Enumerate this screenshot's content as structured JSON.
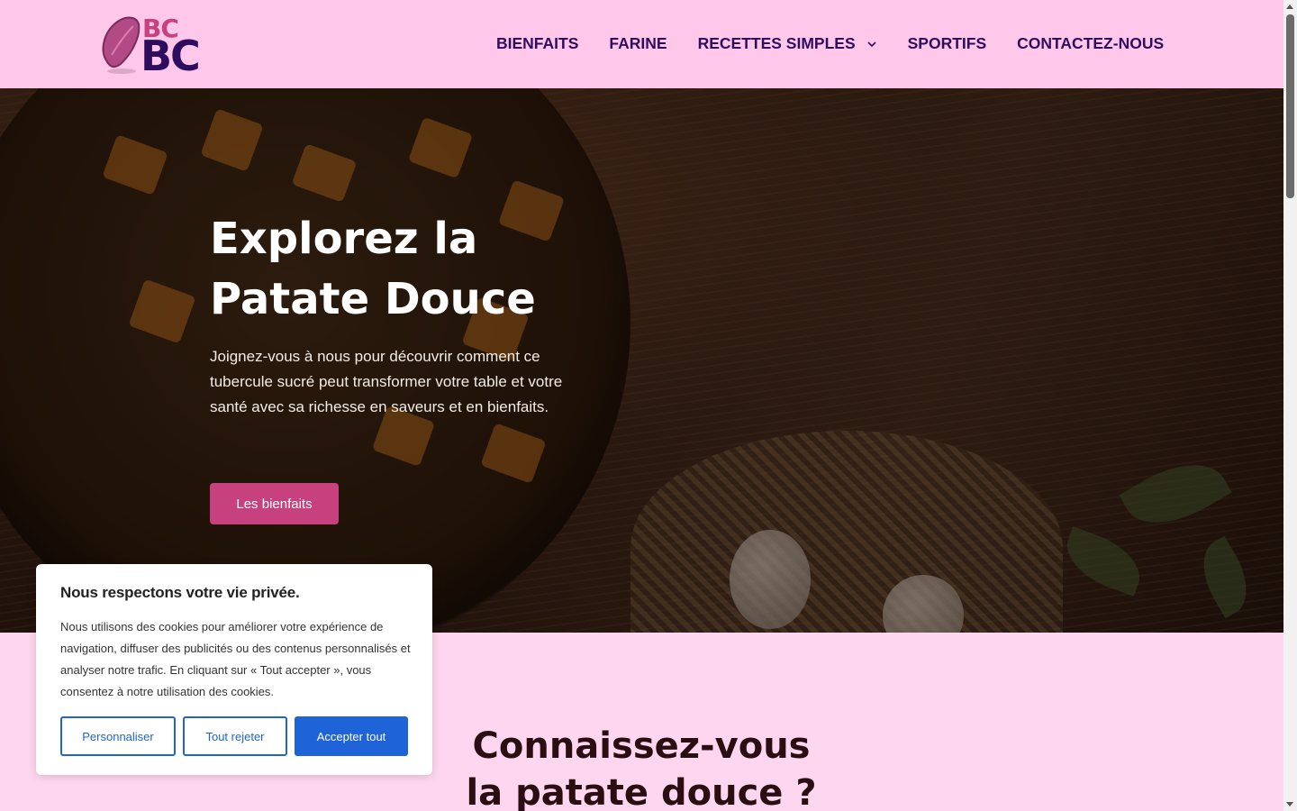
{
  "header": {
    "logo_text_top": "BC",
    "logo_text_bottom": "BC",
    "nav": [
      {
        "label": "BIENFAITS"
      },
      {
        "label": "FARINE"
      },
      {
        "label": "RECETTES SIMPLES"
      },
      {
        "label": "SPORTIFS"
      },
      {
        "label": "CONTACTEZ-NOUS"
      }
    ]
  },
  "hero": {
    "title_line1": "Explorez la",
    "title_line2": "Patate Douce",
    "text": "Joignez-vous à nous pour découvrir comment ce tubercule sucré peut transformer votre table et votre santé avec sa richesse en saveurs et en bienfaits.",
    "button_label": "Les bienfaits"
  },
  "section": {
    "title_line1": "Connaissez-vous",
    "title_line2": "la patate douce ?"
  },
  "cookie": {
    "title": "Nous respectons votre vie privée.",
    "text": "Nous utilisons des cookies pour améliorer votre expérience de navigation, diffuser des publicités ou des contenus personnalisés et analyser notre trafic. En cliquant sur « Tout accepter », vous consentez à notre utilisation des cookies.",
    "btn_customize": "Personnaliser",
    "btn_reject": "Tout rejeter",
    "btn_accept": "Accepter tout"
  },
  "colors": {
    "header_bg": "#ffc7ea",
    "page_bg": "#ffd6ef",
    "brand_purple": "#2f0d5e",
    "brand_pink": "#c8417f",
    "cookie_blue": "#1f63d8"
  },
  "icons": {
    "logo": "sweet-potato-icon",
    "dropdown": "chevron-down-icon"
  }
}
